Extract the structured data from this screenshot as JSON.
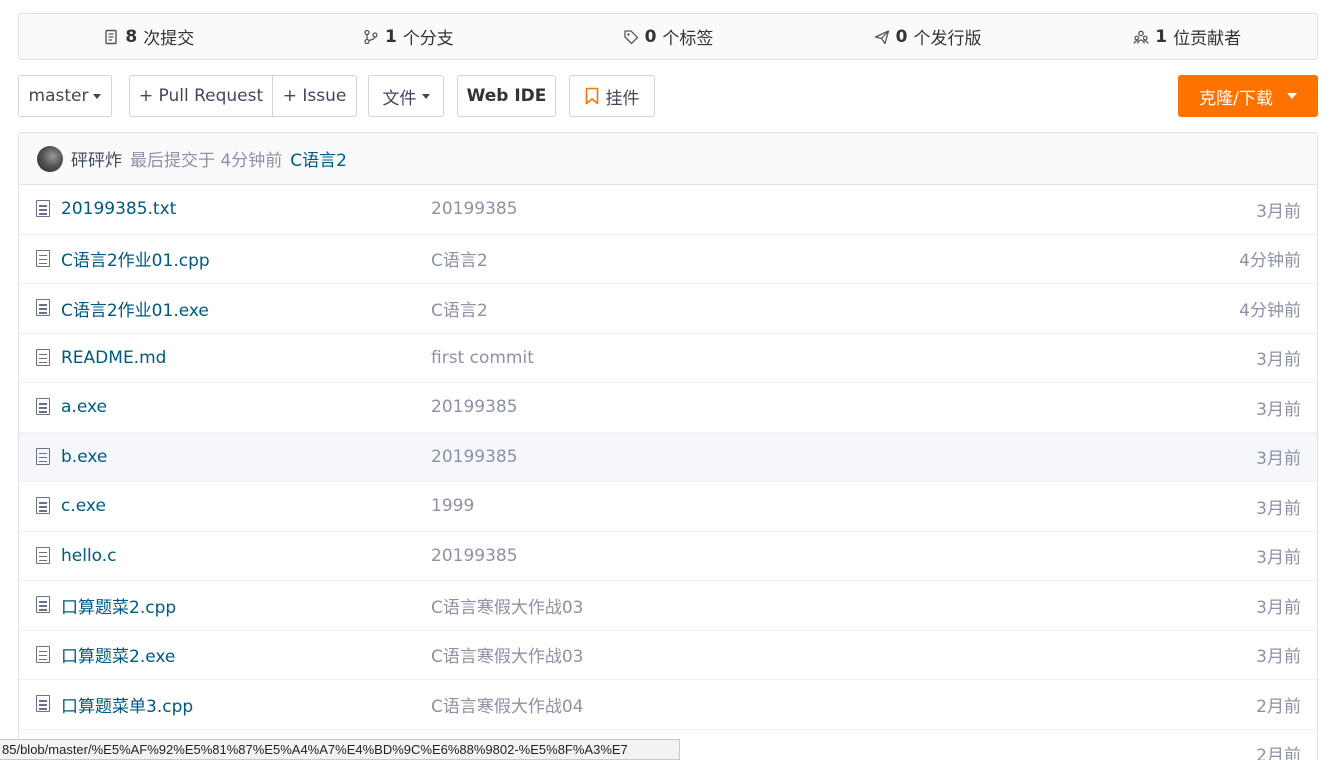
{
  "stats": [
    {
      "icon": "commit-icon",
      "count": "8",
      "label": "次提交"
    },
    {
      "icon": "branch-icon",
      "count": "1",
      "label": "个分支"
    },
    {
      "icon": "tag-icon",
      "count": "0",
      "label": "个标签"
    },
    {
      "icon": "release-icon",
      "count": "0",
      "label": "个发行版"
    },
    {
      "icon": "contributors-icon",
      "count": "1",
      "label": "位贡献者"
    }
  ],
  "toolbar": {
    "branch": "master",
    "pull_request": "+ Pull Request",
    "issue": "+ Issue",
    "files": "文件",
    "web_ide": "Web IDE",
    "widget": "挂件",
    "clone": "克隆/下载"
  },
  "last_commit": {
    "author": "砰砰炸",
    "meta": "最后提交于 4分钟前",
    "message": "C语言2"
  },
  "files": [
    {
      "name": "20199385.txt",
      "message": "20199385",
      "time": "3月前"
    },
    {
      "name": "C语言2作业01.cpp",
      "message": "C语言2",
      "time": "4分钟前"
    },
    {
      "name": "C语言2作业01.exe",
      "message": "C语言2",
      "time": "4分钟前"
    },
    {
      "name": "README.md",
      "message": "first commit",
      "time": "3月前"
    },
    {
      "name": "a.exe",
      "message": "20199385",
      "time": "3月前"
    },
    {
      "name": "b.exe",
      "message": "20199385",
      "time": "3月前"
    },
    {
      "name": "c.exe",
      "message": "1999",
      "time": "3月前"
    },
    {
      "name": "hello.c",
      "message": "20199385",
      "time": "3月前"
    },
    {
      "name": "口算题菜2.cpp",
      "message": "C语言寒假大作战03",
      "time": "3月前"
    },
    {
      "name": "口算题菜2.exe",
      "message": "C语言寒假大作战03",
      "time": "3月前"
    },
    {
      "name": "口算题菜单3.cpp",
      "message": "C语言寒假大作战04",
      "time": "2月前"
    },
    {
      "name": "",
      "message": "",
      "time": "2月前"
    }
  ],
  "status_url": "85/blob/master/%E5%AF%92%E5%81%87%E5%A4%A7%E4%BD%9C%E6%88%9802-%E5%8F%A3%E7"
}
